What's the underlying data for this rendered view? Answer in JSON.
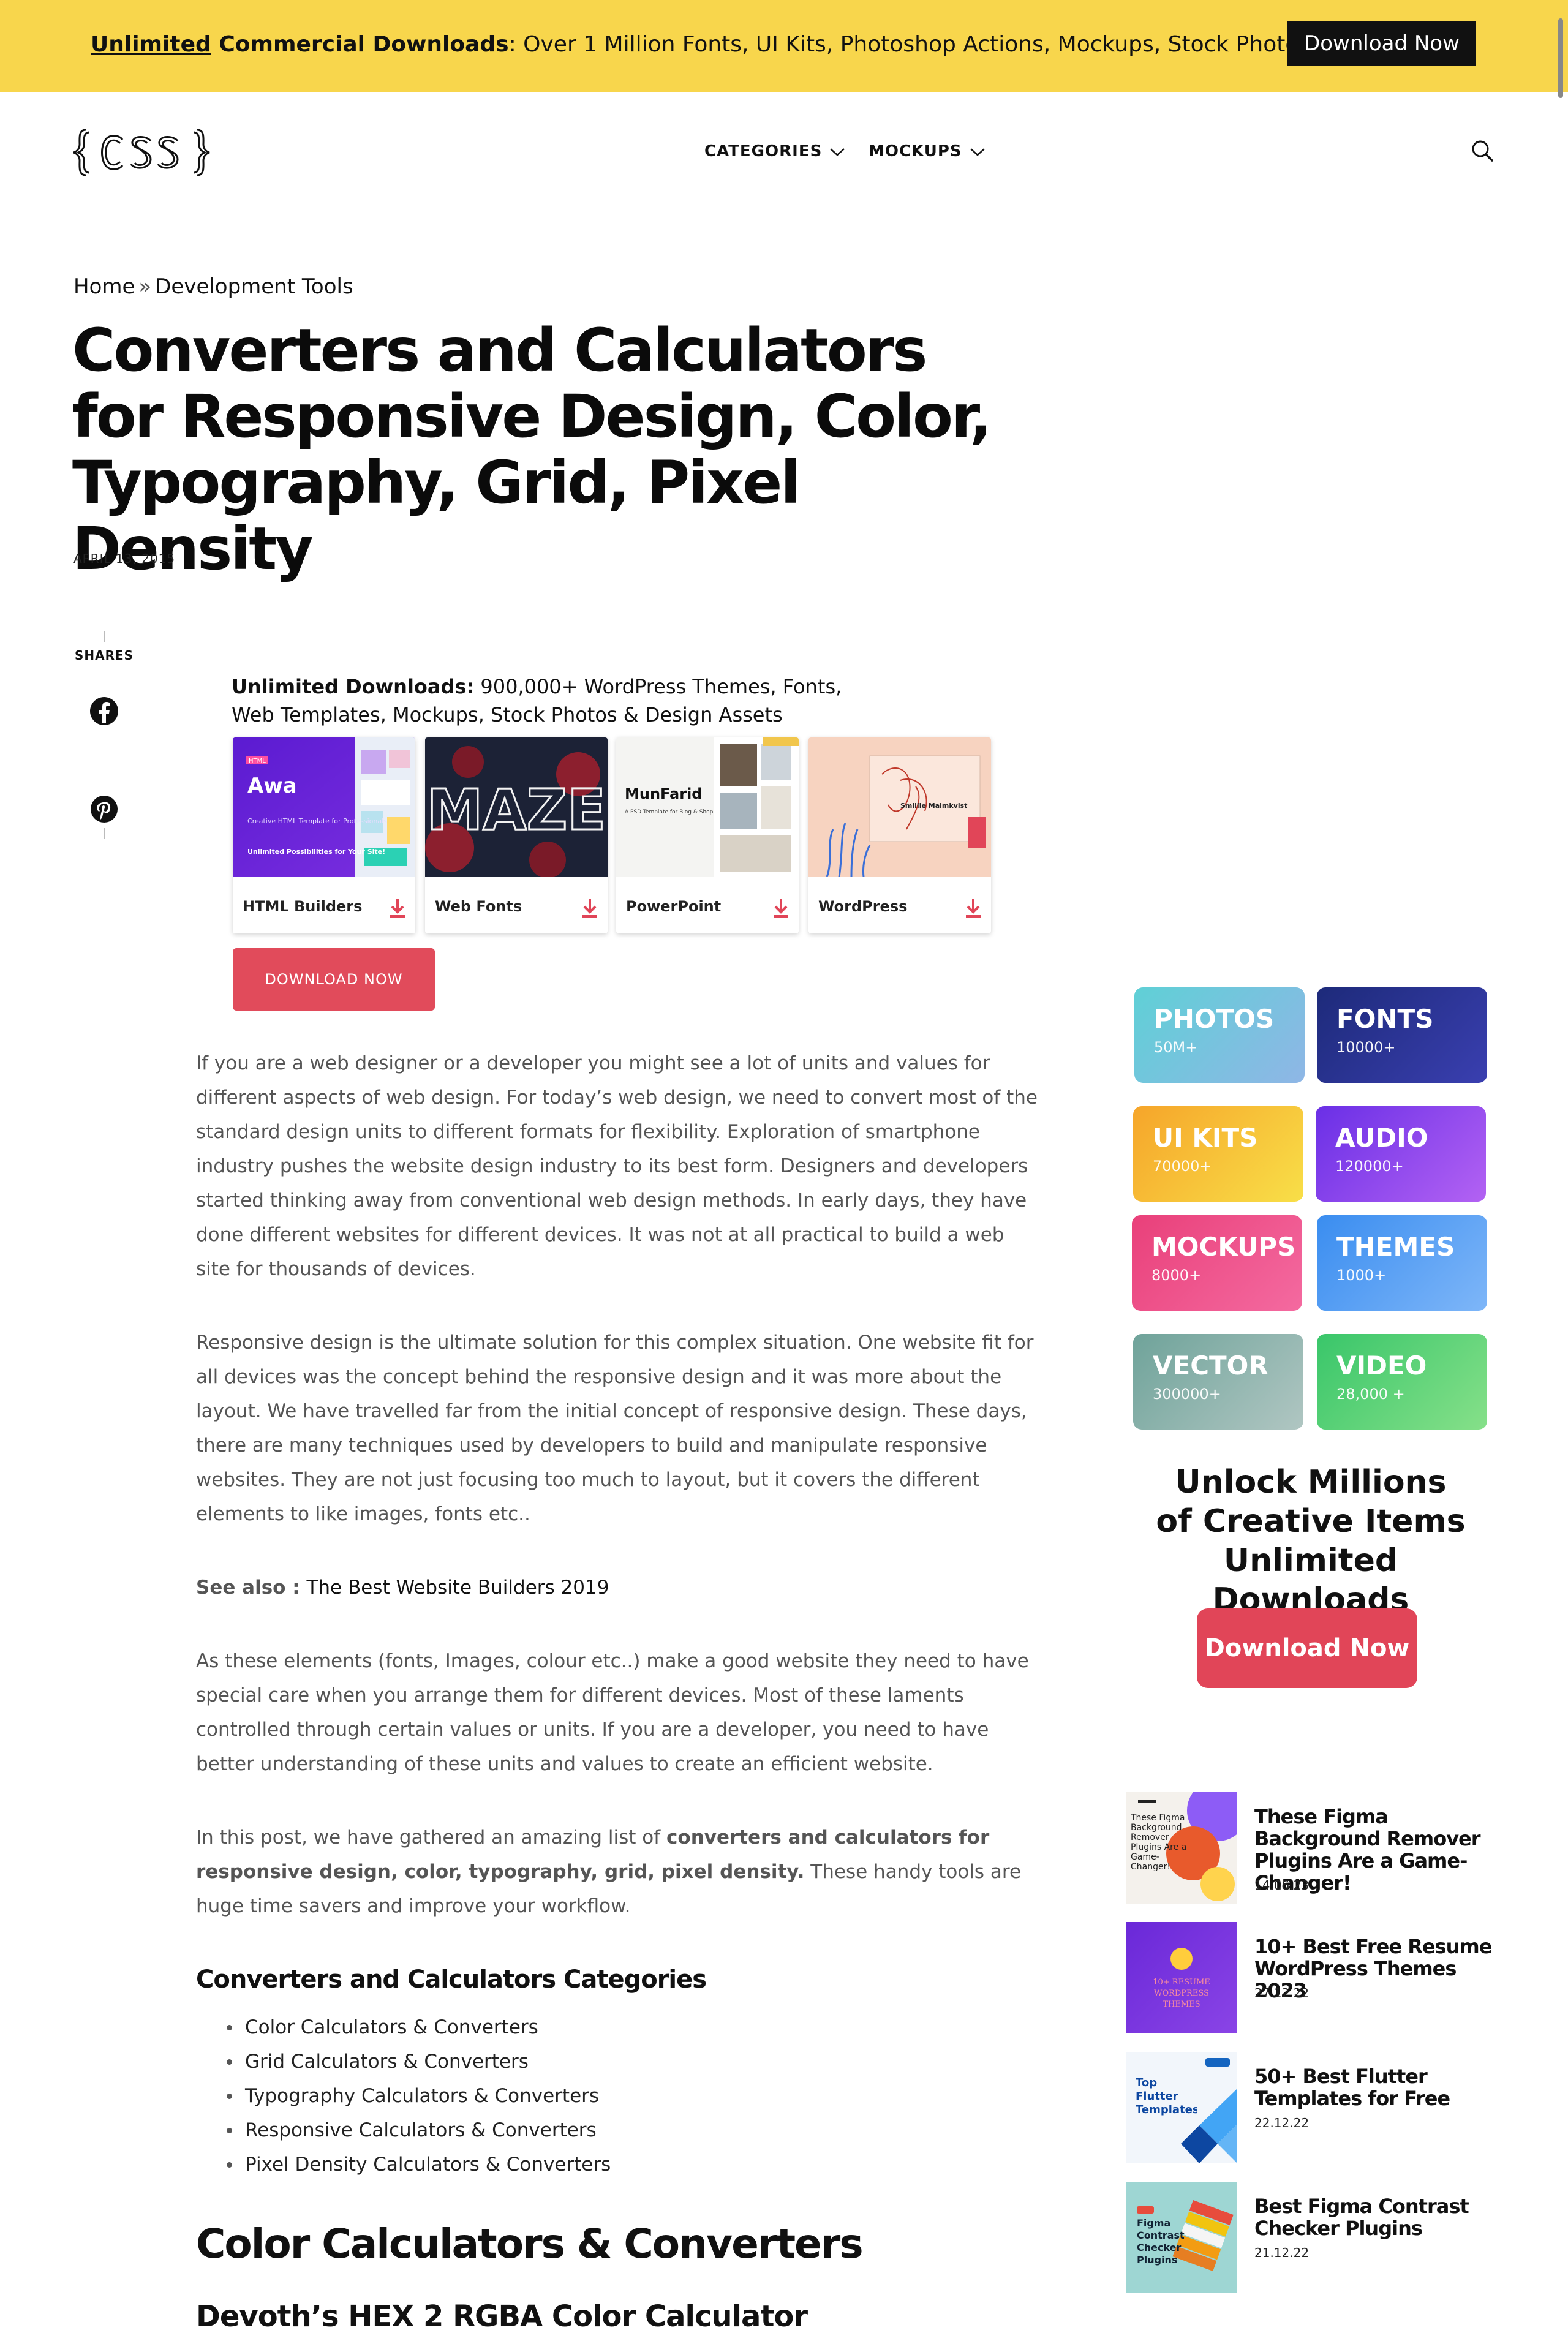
{
  "topbar": {
    "lead_underlined": "Unlimited",
    "lead_bold": " Commercial Downloads",
    "text": ": Over 1 Million Fonts, UI Kits, Photoshop Actions, Mockups, Stock Photos & More",
    "button": "Download Now"
  },
  "header": {
    "logo_text": "{CSS}",
    "nav": [
      {
        "label": "CATEGORIES",
        "icon": "chevron-down-icon"
      },
      {
        "label": "MOCKUPS",
        "icon": "chevron-down-icon"
      }
    ],
    "search_icon": "search-icon"
  },
  "breadcrumb": {
    "home": "Home",
    "sep": "»",
    "current": "Development Tools"
  },
  "article": {
    "title": "Converters and Calculators for Responsive Design, Color, Typography, Grid, Pixel Density",
    "date": "APRIL 13, 2015"
  },
  "share": {
    "label": "SHARES",
    "icons": [
      "facebook-icon",
      "pinterest-icon"
    ]
  },
  "ad": {
    "title_bold": "Unlimited Downloads:",
    "title_rest": " 900,000+ WordPress Themes, Fonts, Web Templates, Mockups, Stock Photos & Design Assets",
    "cards": [
      {
        "label": "HTML Builders",
        "thumb_title": "Awa",
        "thumb_sub": "Creative HTML Template for Professionals",
        "thumb_sub2": "Unlimited Possibilities for Your Site!",
        "badge": "HTML"
      },
      {
        "label": "Web Fonts",
        "thumb_title": "MAZE"
      },
      {
        "label": "PowerPoint",
        "thumb_title": "MunFarid",
        "thumb_sub": "A PSD Template for Blog & Shop"
      },
      {
        "label": "WordPress",
        "thumb_title": "Smillie Malmkvist"
      }
    ],
    "button": "DOWNLOAD NOW"
  },
  "body": {
    "p1": "If you are a web designer or a developer you might see a lot of units and values for different aspects of web design. For today’s web design, we need to convert most of the standard design units to different formats for flexibility. Exploration of smartphone industry pushes the website design industry to its best form. Designers and developers started thinking away from conventional web design methods. In early days, they have done different websites for different devices. It was not at all practical to build a web site for thousands of devices.",
    "p2": "Responsive design is the ultimate solution for this complex situation. One website fit for all devices was the concept behind the responsive design and it was more about the layout. We have travelled far from the initial concept of responsive design. These days, there are many techniques used by developers to build and manipulate responsive websites. They are not just focusing too much to layout, but it covers the different elements to like images, fonts etc..",
    "see_also_label": "See also : ",
    "see_also_link": "The Best Website Builders 2019",
    "p3": "As these elements (fonts, Images, colour etc..) make a good website they need to have special care when you arrange them for different devices. Most of these laments controlled through certain values or units. If you are a developer, you need to have better understanding of these units and values to create an efficient website.",
    "p4_start": "In this post, we have gathered an amazing list of ",
    "p4_bold": "converters and calculators for responsive design, color, typography, grid, pixel density.",
    "p4_end": " These handy tools are huge time savers and improve your workflow.",
    "categories_heading": "Converters and Calculators Categories",
    "categories": [
      "Color Calculators & Converters",
      "Grid Calculators & Converters",
      "Typography Calculators & Converters",
      "Responsive Calculators & Converters",
      "Pixel Density Calculators & Converters"
    ],
    "h2": "Color Calculators & Converters",
    "h4": "Devoth’s HEX 2 RGBA Color Calculator"
  },
  "sidebar": {
    "tiles": [
      {
        "name": "PHOTOS",
        "count": "50M+",
        "colors": [
          "#5fd0d6",
          "#8fb6e6"
        ]
      },
      {
        "name": "FONTS",
        "count": "10000+",
        "colors": [
          "#1d2a7a",
          "#3a3fb0"
        ]
      },
      {
        "name": "UI KITS",
        "count": "70000+",
        "colors": [
          "#f6a52a",
          "#f8df48"
        ]
      },
      {
        "name": "AUDIO",
        "count": "120000+",
        "colors": [
          "#6a2fe6",
          "#b362f3"
        ]
      },
      {
        "name": "MOCKUPS",
        "count": "8000+",
        "colors": [
          "#e9407a",
          "#f46aa0"
        ]
      },
      {
        "name": "THEMES",
        "count": "1000+",
        "colors": [
          "#3a8df0",
          "#7eb6f8"
        ]
      },
      {
        "name": "VECTOR",
        "count": "300000+",
        "colors": [
          "#6fa39a",
          "#b0c6c2"
        ]
      },
      {
        "name": "VIDEO",
        "count": "28,000 +",
        "colors": [
          "#39c66a",
          "#86e089"
        ]
      }
    ],
    "promo_heading_lines": [
      "Unlock Millions",
      "of Creative Items",
      "Unlimited Downloads"
    ],
    "promo_button": "Download Now",
    "posts": [
      {
        "title": "These Figma Background Remover Plugins Are a Game-Changer!",
        "date": "14.06.23",
        "thumb_text": "These Figma Background Remover Plugins Are a Game-Changer!"
      },
      {
        "title": "10+ Best Free Resume WordPress Themes 2023",
        "date": "27.12.22",
        "thumb_text": "10+ RESUME WORDPRESS THEMES"
      },
      {
        "title": "50+ Best Flutter Templates for Free",
        "date": "22.12.22",
        "thumb_text": "Top Flutter Templates"
      },
      {
        "title": "Best Figma Contrast Checker Plugins",
        "date": "21.12.22",
        "thumb_text": "Figma Contrast Checker Plugins"
      }
    ]
  }
}
